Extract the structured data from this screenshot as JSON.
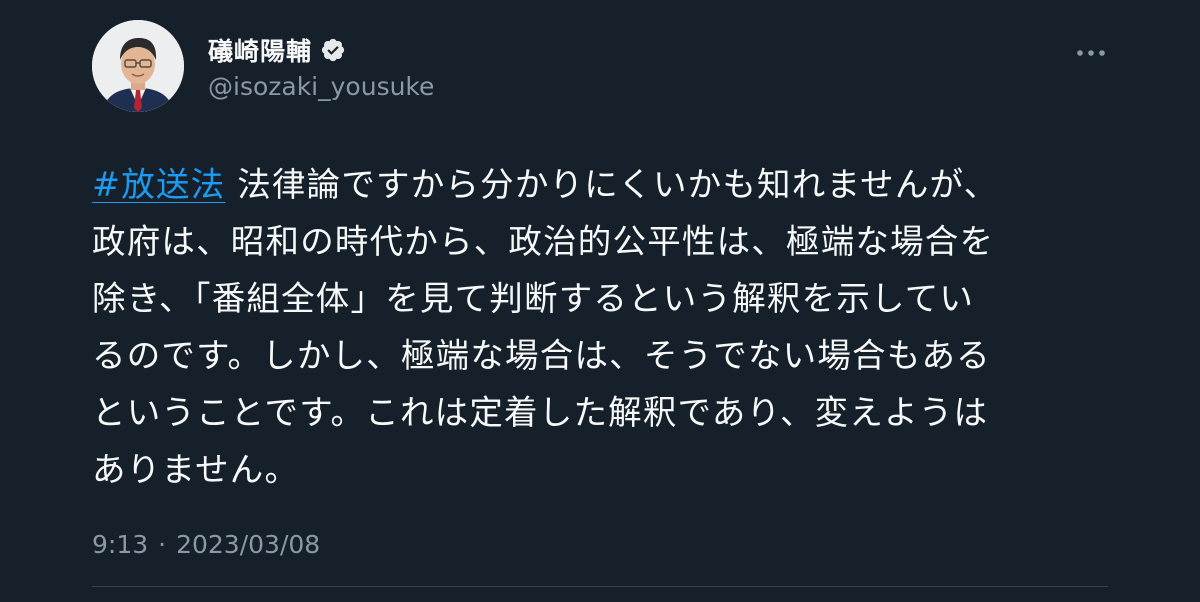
{
  "author": {
    "display_name": "礒崎陽輔",
    "handle": "@isozaki_yousuke",
    "verified": true
  },
  "tweet": {
    "hashtag": "#放送法",
    "lines": [
      " 法律論ですから分かりにくいかも知れませんが、",
      "政府は、昭和の時代から、政治的公平性は、極端な場合を",
      "除き、「番組全体」を見て判断するという解釈を示してい",
      "るのです。しかし、極端な場合は、そうでない場合もある",
      "ということです。これは定着した解釈であり、変えようは",
      "ありません。"
    ],
    "time": "9:13",
    "separator": "·",
    "date": "2023/03/08"
  },
  "icons": {
    "verified": "verified-badge-icon",
    "more": "more-options-icon"
  },
  "colors": {
    "background": "#15202b",
    "hashtag": "#1d9bf0",
    "secondary_text": "#8b98a5",
    "divider": "#38444d"
  }
}
